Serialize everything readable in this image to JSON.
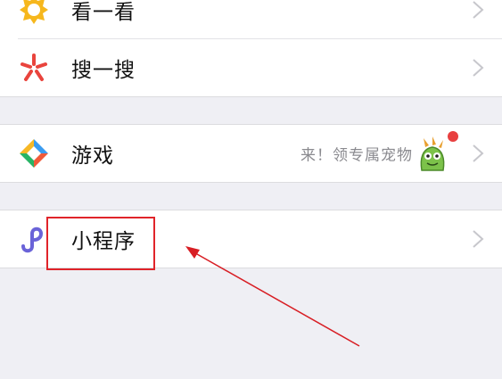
{
  "menu": {
    "look": {
      "label": "看一看",
      "icon": "look-icon"
    },
    "search": {
      "label": "搜一搜",
      "icon": "search-icon"
    },
    "games": {
      "label": "游戏",
      "icon": "games-icon",
      "promo": "来！领专属宠物",
      "promo_icon": "pet-monster-icon",
      "badge_color": "#e84040"
    },
    "mini_programs": {
      "label": "小程序",
      "icon": "mini-program-icon"
    }
  },
  "annotation": {
    "highlight_color": "#e0242a",
    "arrow_color": "#d81e24"
  },
  "colors": {
    "background": "#efeff4",
    "cell": "#ffffff",
    "text": "#111111",
    "subtext": "#8a8a8f",
    "chevron": "#c7c7cc"
  }
}
